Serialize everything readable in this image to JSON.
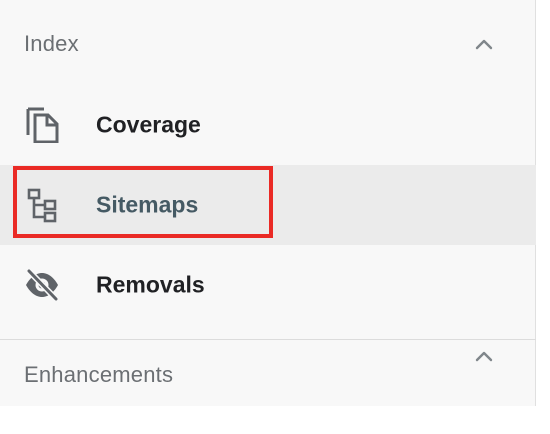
{
  "sections": {
    "index": {
      "title": "Index",
      "expanded": true
    },
    "enhancements": {
      "title": "Enhancements",
      "expanded": true
    }
  },
  "nav": {
    "coverage": {
      "label": "Coverage",
      "icon": "copy-pages-icon"
    },
    "sitemaps": {
      "label": "Sitemaps",
      "icon": "sitemap-tree-icon",
      "selected": true
    },
    "removals": {
      "label": "Removals",
      "icon": "eye-off-icon"
    }
  },
  "colors": {
    "highlight_border": "#ea2a25",
    "selected_bg": "#ebebeb",
    "panel_bg": "#f8f8f8",
    "icon_gray": "#5f6368"
  }
}
